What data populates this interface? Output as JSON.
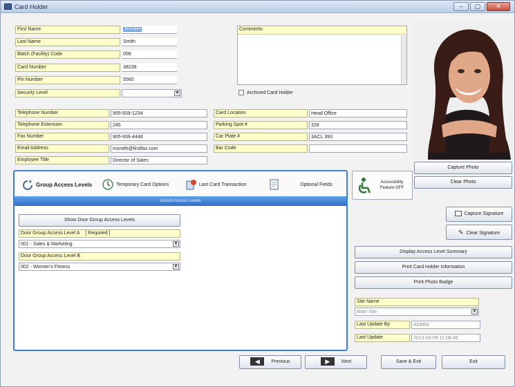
{
  "window": {
    "title": "Card Holder",
    "minimize": "–",
    "maximize": "▢",
    "close": "✕"
  },
  "form": {
    "first_name": {
      "label": "First Name",
      "value": "Jennifer"
    },
    "last_name": {
      "label": "Last Name",
      "value": "Smith"
    },
    "facility": {
      "label": "Batch (Facility) Code",
      "value": "009"
    },
    "card_number": {
      "label": "Card Number",
      "value": "38238"
    },
    "pin": {
      "label": "Pin Number",
      "value": "5560"
    },
    "security_level": {
      "label": "Security Level",
      "value": ""
    },
    "comments": {
      "label": "Comments"
    },
    "archived": {
      "label": "Archived Card Holder"
    },
    "telephone": {
      "label": "Telephone Number",
      "value": "905-939-1234"
    },
    "extension": {
      "label": "Telephone Extension",
      "value": "245"
    },
    "fax": {
      "label": "Fax Number",
      "value": "905-939-4448"
    },
    "email": {
      "label": "Email Address",
      "value": "msmith@firstfax.com"
    },
    "title": {
      "label": "Employee Title",
      "value": "Director of Sales"
    },
    "card_location": {
      "label": "Card Location",
      "value": "Head Office"
    },
    "parking": {
      "label": "Parking Spot #",
      "value": "328"
    },
    "car_plate": {
      "label": "Car Plate #",
      "value": "3ACL 393"
    },
    "bar_code": {
      "label": "Bar Code",
      "value": ""
    }
  },
  "photo_buttons": {
    "capture": "Capture Photo",
    "clear": "Clear Photo"
  },
  "tabs": [
    {
      "label": "Group Access Levels"
    },
    {
      "label": "Temporary Card Options"
    },
    {
      "label": "Last Card Transaction"
    },
    {
      "label": "Optional Fields"
    }
  ],
  "panel": {
    "header": "Access Access Levels",
    "show_button": "Show Door Group Access Levels",
    "access1": {
      "label": "Door Group Access Level A",
      "required": "[ Required ]",
      "value": "001 - Sales & Marketing"
    },
    "access2": {
      "label": "Door Group Access Level B",
      "value": "002 - Women's Fitness"
    }
  },
  "accessibility": {
    "line1": "Accessibility",
    "line2": "Feature OFF"
  },
  "signature": {
    "capture": "Capture Signature",
    "clear": "Clear Signature"
  },
  "actions": {
    "display_access": "Display Access Level Summary",
    "print_info": "Print Card Holder Information",
    "print_badge": "Print Photo Badge"
  },
  "site": {
    "label": "Site Name",
    "value": "Main Site"
  },
  "last_updated_by": {
    "label": "Last Update By",
    "value": "ADMIN"
  },
  "last_update": {
    "label": "Last Update",
    "value": "2013-03-09 11:08:46"
  },
  "nav": {
    "previous": "Previous",
    "next": "Next",
    "save": "Save & Exit",
    "exit": "Exit"
  }
}
